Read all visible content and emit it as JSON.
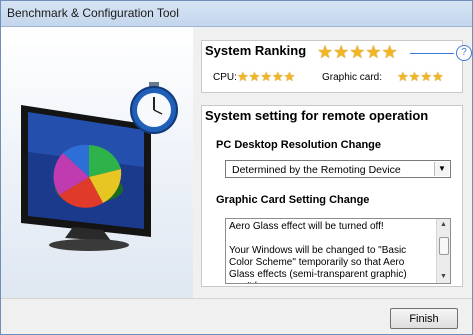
{
  "window": {
    "title": "Benchmark & Configuration Tool"
  },
  "ranking": {
    "title": "System Ranking",
    "overall_stars": 5,
    "cpu_label": "CPU:",
    "cpu_stars": 5,
    "graphic_label": "Graphic card:",
    "graphic_stars": 4,
    "help_glyph": "?"
  },
  "settings": {
    "title": "System setting for remote operation",
    "resolution_label": "PC Desktop Resolution Change",
    "resolution_value": "Determined by the Remoting Device",
    "graphic_label": "Graphic Card Setting Change",
    "graphic_text": [
      "Aero Glass effect will be turned off!",
      "Your Windows will be changed to \"Basic Color Scheme\" temporarily so that Aero Glass effects (semi-transparent graphic) won't be"
    ]
  },
  "footer": {
    "finish_label": "Finish"
  },
  "colors": {
    "star": "#f1b623",
    "accent": "#3f7ad6"
  },
  "icons": {
    "monitor": "monitor-icon",
    "stopwatch": "stopwatch-icon",
    "pie": "pie-chart-icon"
  }
}
